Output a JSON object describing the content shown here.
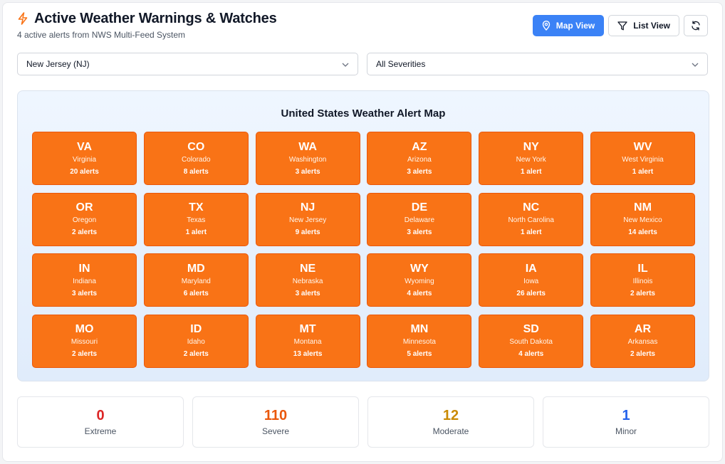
{
  "header": {
    "title": "Active Weather Warnings & Watches",
    "subtitle": "4 active alerts from NWS Multi-Feed System",
    "icon": "lightning-icon",
    "accent": "#f97316"
  },
  "toolbar": {
    "map_view_label": "Map View",
    "list_view_label": "List View",
    "refresh_icon": "refresh-icon"
  },
  "filters": {
    "state_selected": "New Jersey (NJ)",
    "severity_selected": "All Severities"
  },
  "map": {
    "title": "United States Weather Alert Map",
    "tile_color": "#f97316",
    "states": [
      {
        "abbr": "VA",
        "name": "Virginia",
        "alerts": "20 alerts"
      },
      {
        "abbr": "CO",
        "name": "Colorado",
        "alerts": "8 alerts"
      },
      {
        "abbr": "WA",
        "name": "Washington",
        "alerts": "3 alerts"
      },
      {
        "abbr": "AZ",
        "name": "Arizona",
        "alerts": "3 alerts"
      },
      {
        "abbr": "NY",
        "name": "New York",
        "alerts": "1 alert"
      },
      {
        "abbr": "WV",
        "name": "West Virginia",
        "alerts": "1 alert"
      },
      {
        "abbr": "OR",
        "name": "Oregon",
        "alerts": "2 alerts"
      },
      {
        "abbr": "TX",
        "name": "Texas",
        "alerts": "1 alert"
      },
      {
        "abbr": "NJ",
        "name": "New Jersey",
        "alerts": "9 alerts"
      },
      {
        "abbr": "DE",
        "name": "Delaware",
        "alerts": "3 alerts"
      },
      {
        "abbr": "NC",
        "name": "North Carolina",
        "alerts": "1 alert"
      },
      {
        "abbr": "NM",
        "name": "New Mexico",
        "alerts": "14 alerts"
      },
      {
        "abbr": "IN",
        "name": "Indiana",
        "alerts": "3 alerts"
      },
      {
        "abbr": "MD",
        "name": "Maryland",
        "alerts": "6 alerts"
      },
      {
        "abbr": "NE",
        "name": "Nebraska",
        "alerts": "3 alerts"
      },
      {
        "abbr": "WY",
        "name": "Wyoming",
        "alerts": "4 alerts"
      },
      {
        "abbr": "IA",
        "name": "Iowa",
        "alerts": "26 alerts"
      },
      {
        "abbr": "IL",
        "name": "Illinois",
        "alerts": "2 alerts"
      },
      {
        "abbr": "MO",
        "name": "Missouri",
        "alerts": "2 alerts"
      },
      {
        "abbr": "ID",
        "name": "Idaho",
        "alerts": "2 alerts"
      },
      {
        "abbr": "MT",
        "name": "Montana",
        "alerts": "13 alerts"
      },
      {
        "abbr": "MN",
        "name": "Minnesota",
        "alerts": "5 alerts"
      },
      {
        "abbr": "SD",
        "name": "South Dakota",
        "alerts": "4 alerts"
      },
      {
        "abbr": "AR",
        "name": "Arkansas",
        "alerts": "2 alerts"
      }
    ]
  },
  "stats": [
    {
      "value": "0",
      "label": "Extreme",
      "color": "#dc2626"
    },
    {
      "value": "110",
      "label": "Severe",
      "color": "#ea580c"
    },
    {
      "value": "12",
      "label": "Moderate",
      "color": "#ca8a04"
    },
    {
      "value": "1",
      "label": "Minor",
      "color": "#2563eb"
    }
  ]
}
